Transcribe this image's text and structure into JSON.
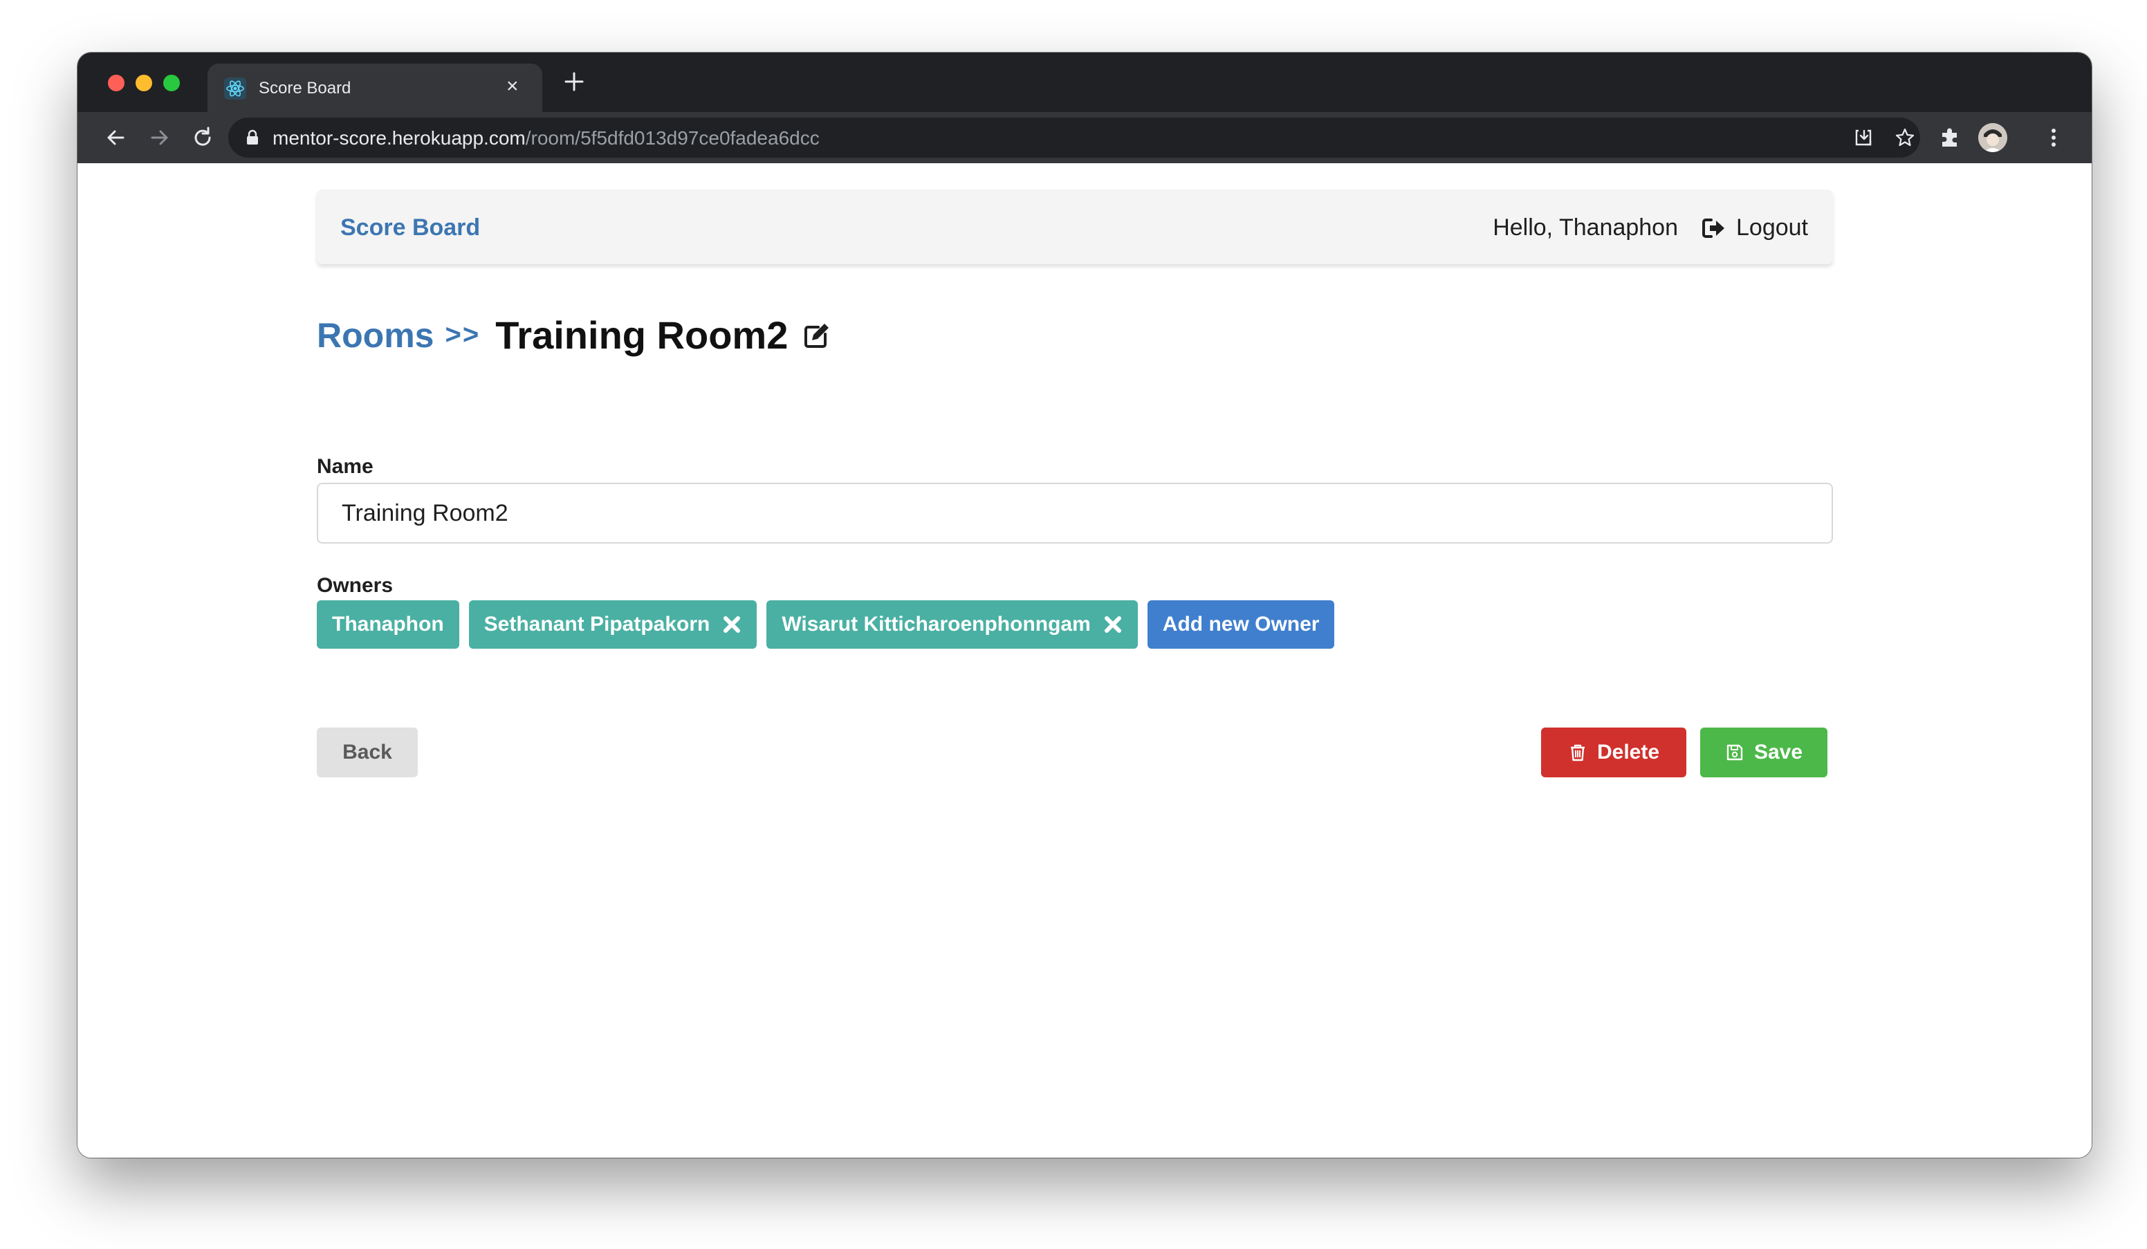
{
  "browser": {
    "tab_title": "Score Board",
    "tab_icon": "react-atom-icon",
    "url_host": "mentor-score.herokuapp.com",
    "url_path": "/room/5f5dfd013d97ce0fadea6dcc"
  },
  "navbar": {
    "brand": "Score Board",
    "greeting": "Hello, Thanaphon",
    "logout_label": "Logout"
  },
  "breadcrumb": {
    "rooms_link": "Rooms",
    "separator": ">>",
    "title": "Training Room2"
  },
  "form": {
    "name_label": "Name",
    "name_value": "Training Room2",
    "owners_label": "Owners",
    "owners": [
      {
        "name": "Thanaphon",
        "removable": false
      },
      {
        "name": "Sethanant Pipatpakorn",
        "removable": true
      },
      {
        "name": "Wisarut Kitticharoenphonngam",
        "removable": true
      }
    ],
    "add_owner_label": "Add new Owner"
  },
  "actions": {
    "back_label": "Back",
    "delete_label": "Delete",
    "save_label": "Save"
  },
  "colors": {
    "brand_blue": "#3c76b2",
    "chip_teal": "#4ab0a3",
    "add_blue": "#3f7fce",
    "delete_red": "#d0312d",
    "save_green": "#4cb849"
  }
}
